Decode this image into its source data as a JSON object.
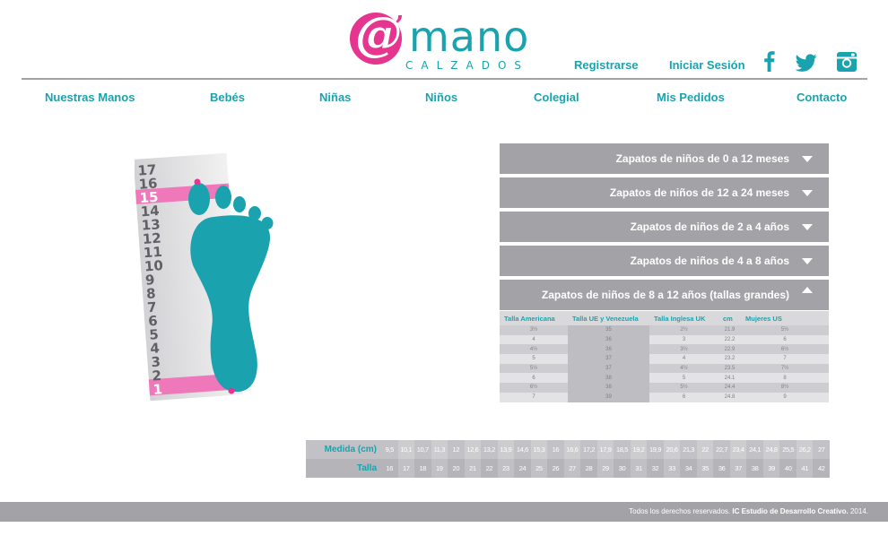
{
  "brand": {
    "logo_mark": "@",
    "logo_apostrophe": "’",
    "logo_word": "mano",
    "logo_sub": "CALZADOS",
    "colors": {
      "teal": "#1aa3ae",
      "pink": "#e6358e",
      "gray": "#a3a3a7"
    }
  },
  "header": {
    "register": "Registrarse",
    "login": "Iniciar Sesión",
    "social": [
      "facebook-icon",
      "twitter-icon",
      "instagram-icon"
    ]
  },
  "nav": [
    "Nuestras Manos",
    "Bebés",
    "Niñas",
    "Niños",
    "Colegial",
    "Mis Pedidos",
    "Contacto"
  ],
  "foot_ruler": {
    "numbers": [
      "17",
      "16",
      "15",
      "14",
      "13",
      "12",
      "11",
      "10",
      "9",
      "8",
      "7",
      "6",
      "5",
      "4",
      "3",
      "2",
      "1"
    ],
    "highlight": [
      "15",
      "1"
    ]
  },
  "accordion": [
    {
      "label": "Zapatos de niños de 0 a 12 meses",
      "expanded": false
    },
    {
      "label": "Zapatos de niños de 12 a 24 meses",
      "expanded": false
    },
    {
      "label": "Zapatos de niños de 2 a 4 años",
      "expanded": false
    },
    {
      "label": "Zapatos de niños de 4 a 8 años",
      "expanded": false
    },
    {
      "label": "Zapatos de niños de 8 a 12 años (tallas grandes)",
      "expanded": true
    }
  ],
  "size_table": {
    "headers": [
      "Talla Americana",
      "Talla UE y Venezuela",
      "Talla Inglesa UK",
      "cm",
      "Mujeres US"
    ],
    "rows": [
      [
        "3½",
        "35",
        "2½",
        "21.9",
        "5½"
      ],
      [
        "4",
        "36",
        "3",
        "22.2",
        "6"
      ],
      [
        "4½",
        "36",
        "3½",
        "22.9",
        "6½"
      ],
      [
        "5",
        "37",
        "4",
        "23.2",
        "7"
      ],
      [
        "5½",
        "37",
        "4½",
        "23.5",
        "7½"
      ],
      [
        "6",
        "38",
        "5",
        "24.1",
        "8"
      ],
      [
        "6½",
        "38",
        "5½",
        "24.4",
        "8½"
      ],
      [
        "7",
        "39",
        "6",
        "24.8",
        "9"
      ]
    ]
  },
  "measure": {
    "row1_label": "Medida (cm)",
    "row2_label": "Talla",
    "medida": [
      "9,5",
      "10,1",
      "10,7",
      "11,3",
      "12",
      "12,6",
      "13,2",
      "13,9",
      "14,6",
      "15,3",
      "16",
      "16,6",
      "17,2",
      "17,9",
      "18,5",
      "19,2",
      "19,9",
      "20,6",
      "21,3",
      "22",
      "22,7",
      "23,4",
      "24,1",
      "24,8",
      "25,5",
      "26,2",
      "27"
    ],
    "talla": [
      "16",
      "17",
      "18",
      "19",
      "20",
      "21",
      "22",
      "23",
      "24",
      "25",
      "26",
      "27",
      "28",
      "29",
      "30",
      "31",
      "32",
      "33",
      "34",
      "35",
      "36",
      "37",
      "38",
      "39",
      "40",
      "41",
      "42"
    ]
  },
  "footer": {
    "text": "Todos los derechos reservados.",
    "company": "IC Estudio de Desarrollo Creativo.",
    "year": "2014."
  }
}
